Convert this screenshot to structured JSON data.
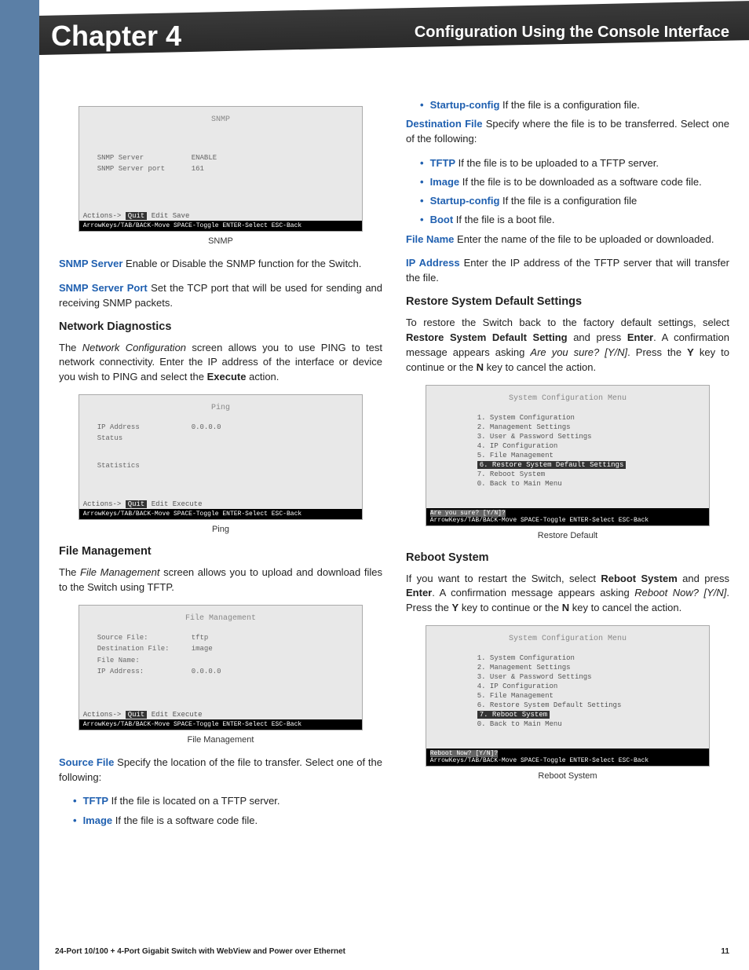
{
  "header": {
    "chapter": "Chapter 4",
    "breadcrumb": "Configuration Using the Console Interface"
  },
  "left": {
    "fig_snmp": {
      "title": "SNMP",
      "rows": [
        {
          "label": "SNMP Server",
          "value": "ENABLE"
        },
        {
          "label": "SNMP Server port",
          "value": "161"
        }
      ],
      "actions": "Actions-> Quit  Edit  Save",
      "footer": "ArrowKeys/TAB/BACK-Move  SPACE-Toggle  ENTER-Select  ESC-Back",
      "caption": "SNMP"
    },
    "snmp_server_term": "SNMP Server",
    "snmp_server_text": "  Enable or Disable the SNMP function for the Switch.",
    "snmp_port_term": "SNMP Server Port",
    "snmp_port_text": "  Set the TCP port that will be used for sending and receiving SNMP packets.",
    "h_netdiag": "Network Diagnostics",
    "netdiag_p1_a": "The ",
    "netdiag_p1_i": "Network Configuration",
    "netdiag_p1_b": " screen allows you to use PING to test network connectivity. Enter the IP address of the interface or device you wish to PING and select the ",
    "netdiag_p1_bold": "Execute",
    "netdiag_p1_c": " action.",
    "fig_ping": {
      "title": "Ping",
      "row_ip": {
        "label": "IP Address",
        "value": "0.0.0.0"
      },
      "row_status": "Status",
      "row_stats": "Statistics",
      "actions": "Actions-> Quit  Edit  Execute",
      "footer": "ArrowKeys/TAB/BACK-Move  SPACE-Toggle  ENTER-Select  ESC-Back",
      "caption": "Ping"
    },
    "h_filemgmt": "File Management",
    "filemgmt_p_a": "The ",
    "filemgmt_p_i": "File Management",
    "filemgmt_p_b": " screen allows you to upload and download files to the Switch using TFTP.",
    "fig_fm": {
      "title": "File Management",
      "rows": [
        {
          "label": "Source File:",
          "value": "tftp"
        },
        {
          "label": "Destination File:",
          "value": "image"
        },
        {
          "label": "File Name:",
          "value": ""
        },
        {
          "label": "IP Address:",
          "value": "0.0.0.0"
        }
      ],
      "actions": "Actions-> Quit  Edit  Execute",
      "footer": "ArrowKeys/TAB/BACK-Move  SPACE-Toggle  ENTER-Select  ESC-Back",
      "caption": "File Management"
    },
    "srcfile_term": "Source File",
    "srcfile_text": "  Specify the location of the file to transfer. Select one of the following:",
    "src_b1_term": "TFTP",
    "src_b1_text": "  If the file is located on a TFTP server.",
    "src_b2_term": "Image",
    "src_b2_text": "  If the file is a software code file."
  },
  "right": {
    "src_b3_term": "Startup-config",
    "src_b3_text": "  If the file is a configuration file.",
    "dest_term": "Destination File",
    "dest_text": "   Specify where the file is to be transferred. Select one of the following:",
    "dest_b1_term": "TFTP",
    "dest_b1_text": "  If the file is to be uploaded to a TFTP server.",
    "dest_b2_term": "Image",
    "dest_b2_text": "  If the file is to be downloaded as a software code file.",
    "dest_b3_term": "Startup-config",
    "dest_b3_text": "  If the file is a configuration file",
    "dest_b4_term": "Boot",
    "dest_b4_text": "  If the file is a boot file.",
    "fname_term": "File Name",
    "fname_text": "  Enter the name of the file to be uploaded or downloaded.",
    "ip_term": "IP Address",
    "ip_text": "  Enter the IP address of the TFTP server that will transfer the file.",
    "h_restore": "Restore System Default Settings",
    "restore_p_a": "To restore the Switch back to the factory default settings, select ",
    "restore_p_b1": "Restore System Default Setting",
    "restore_p_b": " and press ",
    "restore_p_b2": "Enter",
    "restore_p_c": ". A confirmation message appears asking ",
    "restore_p_i": "Are you sure? [Y/N]",
    "restore_p_d": ". Press the ",
    "restore_p_y": "Y",
    "restore_p_e": " key to continue or the ",
    "restore_p_n": "N",
    "restore_p_f": " key to cancel the action.",
    "fig_restore": {
      "title": "System Configuration Menu",
      "items": [
        "1. System Configuration",
        "2. Management Settings",
        "3. User & Password Settings",
        "4. IP Configuration",
        "5. File Management"
      ],
      "hl": "6. Restore System Default Settings",
      "items2": [
        "7. Reboot System",
        "0. Back to Main Menu"
      ],
      "prompt": "Are you sure? [Y/N]?",
      "footer": "ArrowKeys/TAB/BACK-Move  SPACE-Toggle  ENTER-Select  ESC-Back",
      "caption": "Restore Default"
    },
    "h_reboot": "Reboot System",
    "reboot_p_a": "If you want to restart the Switch, select ",
    "reboot_p_b1": "Reboot System",
    "reboot_p_b": " and press ",
    "reboot_p_b2": "Enter",
    "reboot_p_c": ". A confirmation message appears asking ",
    "reboot_p_i": "Reboot Now? [Y/N]",
    "reboot_p_d": ". Press the ",
    "reboot_p_y": "Y",
    "reboot_p_e": " key to continue or the ",
    "reboot_p_n": "N",
    "reboot_p_f": " key to cancel the action.",
    "fig_reboot": {
      "title": "System Configuration Menu",
      "items": [
        "1. System Configuration",
        "2. Management Settings",
        "3. User & Password Settings",
        "4. IP Configuration",
        "5. File Management",
        "6. Restore System Default Settings"
      ],
      "hl": "7. Reboot System",
      "items2": [
        "0. Back to Main Menu"
      ],
      "prompt": "Reboot Now? [Y/N]?",
      "footer": "ArrowKeys/TAB/BACK-Move  SPACE-Toggle  ENTER-Select  ESC-Back",
      "caption": "Reboot System"
    }
  },
  "footer": {
    "product": "24-Port 10/100 + 4-Port Gigabit Switch with WebView and Power over Ethernet",
    "page": "11"
  }
}
